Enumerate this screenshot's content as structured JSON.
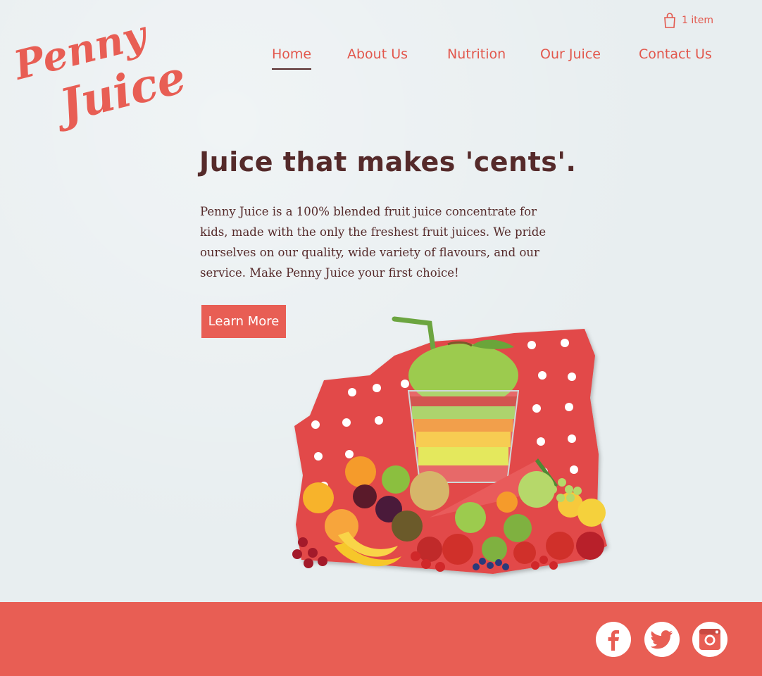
{
  "brand": {
    "logo_line1": "Penny",
    "logo_line2": "Juice",
    "accent_color": "#e85e54",
    "text_color": "#552a2a",
    "background_color": "#e8eef0"
  },
  "cart": {
    "icon": "shopping-bag-icon",
    "label": "1 item"
  },
  "nav": {
    "items": [
      {
        "label": "Home",
        "active": true
      },
      {
        "label": "About Us",
        "active": false
      },
      {
        "label": "Nutrition",
        "active": false
      },
      {
        "label": "Our Juice",
        "active": false
      },
      {
        "label": "Contact Us",
        "active": false
      }
    ]
  },
  "hero": {
    "headline": "Juice that makes 'cents'.",
    "body": "Penny Juice is a 100% blended fruit juice concentrate for kids, made with the only the freshest fruit juices. We pride ourselves on our quality, wide variety of flavours, and our service. Make Penny Juice your first choice!",
    "cta_label": "Learn More",
    "image": "juice-glass-with-fruit-image"
  },
  "footer": {
    "social": [
      {
        "icon": "facebook-icon"
      },
      {
        "icon": "twitter-icon"
      },
      {
        "icon": "instagram-icon"
      }
    ]
  }
}
